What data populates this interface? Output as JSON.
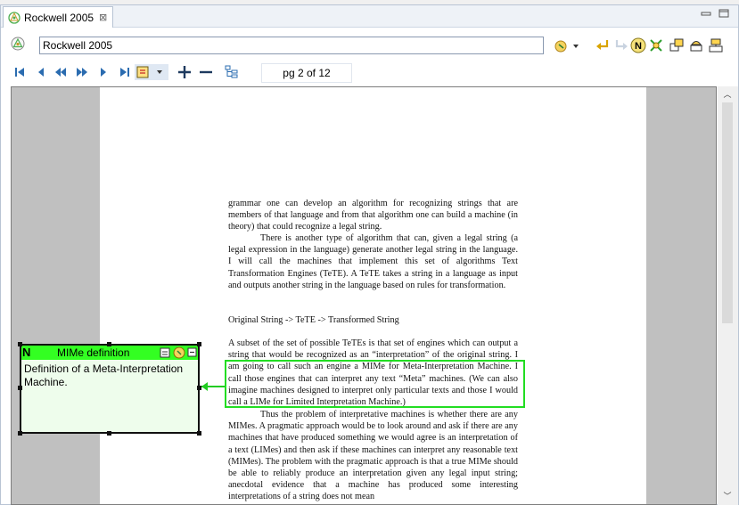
{
  "tab": {
    "title": "Rockwell 2005",
    "close": "⊠"
  },
  "address": {
    "value": "Rockwell 2005"
  },
  "nav": {
    "page_indicator": "pg 2 of 12"
  },
  "document": {
    "paragraphs": [
      {
        "indent": false,
        "text": "grammar one can develop an algorithm for recognizing strings that are members of that language and from that algorithm one can build a machine (in theory) that could recognize a legal string."
      },
      {
        "indent": true,
        "text": "There is another type of algorithm that can, given a legal string (a legal expression in the language) generate another legal string in the language. I will call the machines that implement this set of algorithms Text Transformation Engines (TeTE). A TeTE takes a string in a language as input and outputs another string in the language based on rules for transformation."
      },
      {
        "indent": false,
        "text": "Original String -> TeTE -> Transformed String"
      },
      {
        "indent": false,
        "text": "A subset of the set of possible TeTEs is that set of engines which can output a string that would be recognized as an “interpretation” of the original string. I am going to call such an engine a MIMe for Meta-Interpretation Machine. I call those engines that can interpret any text “Meta” machines. (We can also imagine machines designed to interpret only particular texts and those I would call a LIMe for Limited Interpretation Machine.)"
      },
      {
        "indent": true,
        "text": "Thus the problem of interpretative machines is whether there are any MIMes. A pragmatic approach would be to look around and ask if there are any machines that have produced something we would agree is an interpretation of a text (LIMes) and then ask if these machines can interpret any reasonable text (MIMes). The problem with the pragmatic approach is that a true MIMe should be able to reliably produce an interpretation given any legal input string; anecdotal evidence that a machine has produced some interesting interpretations of a string does not mean"
      }
    ]
  },
  "note": {
    "badge": "N",
    "title": "MIMe definition",
    "body": "Definition of a Meta-Interpretation Machine."
  },
  "colors": {
    "note_header": "#33ff22",
    "note_body": "#eefdec",
    "highlight": "#22dd22"
  }
}
